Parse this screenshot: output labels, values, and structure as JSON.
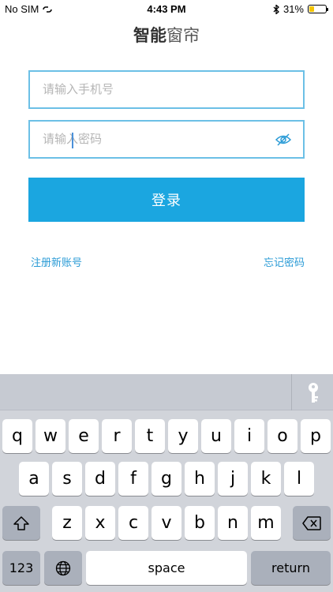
{
  "status_bar": {
    "carrier": "No SIM",
    "time": "4:43 PM",
    "battery": "31%",
    "battery_level": 0.31
  },
  "header": {
    "title_bold": "智能",
    "title_light": "窗帘"
  },
  "form": {
    "phone_placeholder": "请输入手机号",
    "password_placeholder": "请输入密码",
    "login_label": "登录",
    "register_label": "注册新账号",
    "forgot_label": "忘记密码"
  },
  "keyboard": {
    "row1": [
      "q",
      "w",
      "e",
      "r",
      "t",
      "y",
      "u",
      "i",
      "o",
      "p"
    ],
    "row2": [
      "a",
      "s",
      "d",
      "f",
      "g",
      "h",
      "j",
      "k",
      "l"
    ],
    "row3": [
      "z",
      "x",
      "c",
      "v",
      "b",
      "n",
      "m"
    ],
    "numbers_label": "123",
    "space_label": "space",
    "return_label": "return"
  },
  "colors": {
    "accent": "#1ba6e0",
    "field_border": "#6cc0e6",
    "link": "#2a9bd6"
  },
  "icons": [
    "wifi-link-icon",
    "bluetooth-icon",
    "battery-icon",
    "eye-hidden-icon",
    "key-icon",
    "shift-icon",
    "delete-icon",
    "globe-icon"
  ]
}
